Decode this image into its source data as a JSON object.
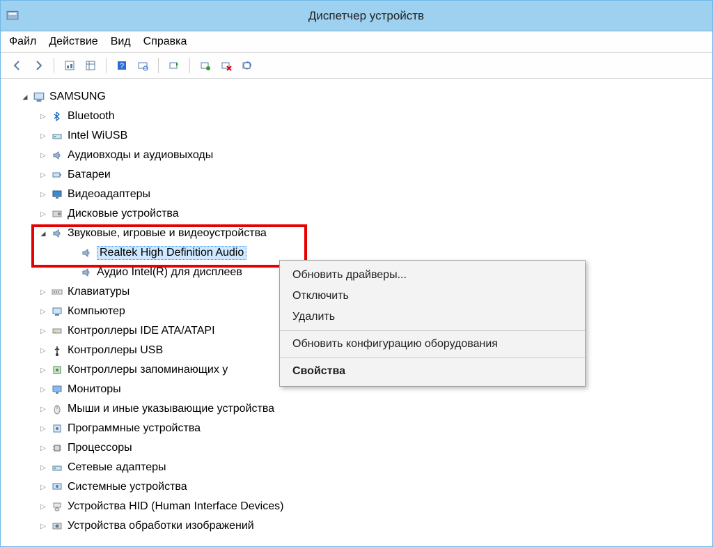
{
  "title": "Диспетчер устройств",
  "menu": {
    "file": "Файл",
    "action": "Действие",
    "view": "Вид",
    "help": "Справка"
  },
  "root": "SAMSUNG",
  "devices": [
    {
      "label": "Bluetooth",
      "icon": "bluetooth"
    },
    {
      "label": "Intel WiUSB",
      "icon": "net"
    },
    {
      "label": "Аудиовходы и аудиовыходы",
      "icon": "speaker"
    },
    {
      "label": "Батареи",
      "icon": "battery"
    },
    {
      "label": "Видеоадаптеры",
      "icon": "display"
    },
    {
      "label": "Дисковые устройства",
      "icon": "disk"
    },
    {
      "label": "Звуковые, игровые и видеоустройства",
      "icon": "speaker",
      "expanded": true,
      "children": [
        {
          "label": "Realtek High Definition Audio",
          "icon": "speaker",
          "selected": true
        },
        {
          "label": "Аудио Intel(R) для дисплеев",
          "icon": "speaker"
        }
      ]
    },
    {
      "label": "Клавиатуры",
      "icon": "keyboard"
    },
    {
      "label": "Компьютер",
      "icon": "computer"
    },
    {
      "label": "Контроллеры IDE ATA/ATAPI",
      "icon": "ide"
    },
    {
      "label": "Контроллеры USB",
      "icon": "usb"
    },
    {
      "label": "Контроллеры запоминающих у",
      "icon": "storage"
    },
    {
      "label": "Мониторы",
      "icon": "monitor"
    },
    {
      "label": "Мыши и иные указывающие устройства",
      "icon": "mouse"
    },
    {
      "label": "Программные устройства",
      "icon": "software"
    },
    {
      "label": "Процессоры",
      "icon": "cpu"
    },
    {
      "label": "Сетевые адаптеры",
      "icon": "net"
    },
    {
      "label": "Системные устройства",
      "icon": "system"
    },
    {
      "label": "Устройства HID (Human Interface Devices)",
      "icon": "hid"
    },
    {
      "label": "Устройства обработки изображений",
      "icon": "imaging"
    }
  ],
  "context": {
    "update": "Обновить драйверы...",
    "disable": "Отключить",
    "delete": "Удалить",
    "scan": "Обновить конфигурацию оборудования",
    "props": "Свойства"
  }
}
